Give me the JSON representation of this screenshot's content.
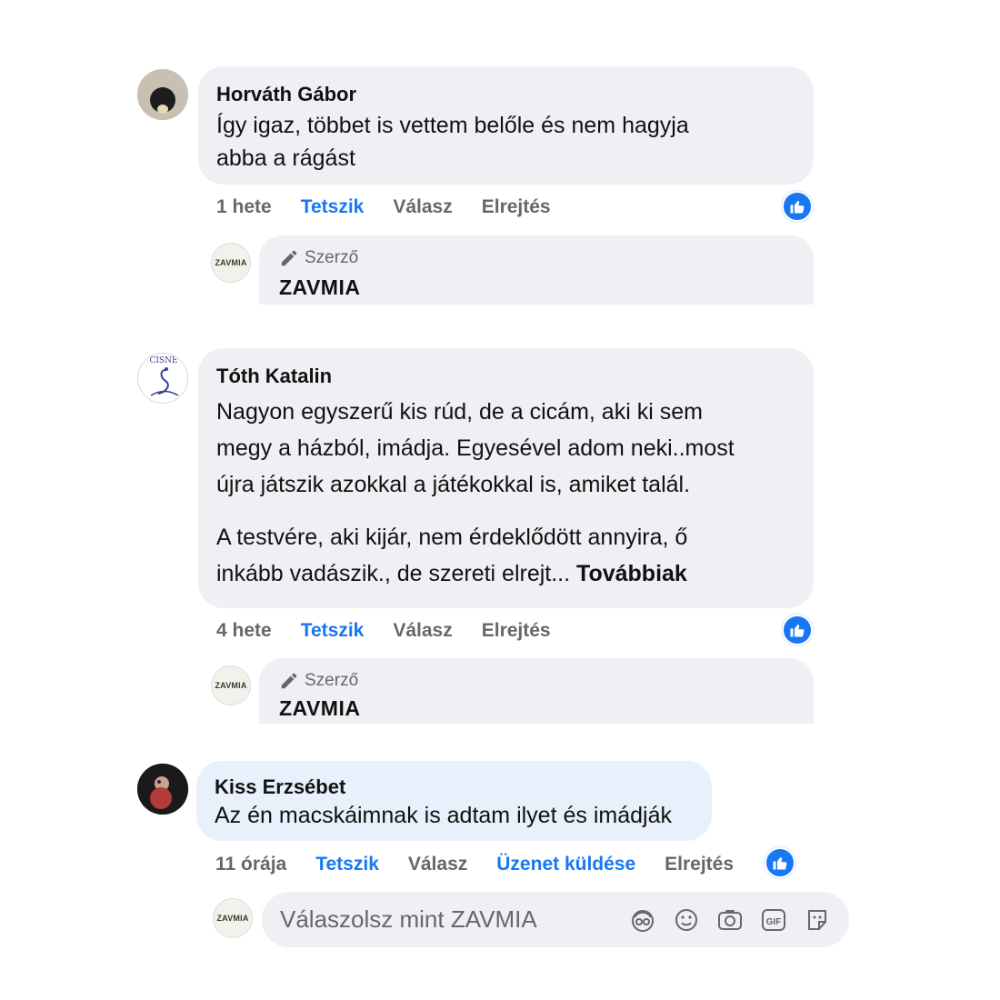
{
  "comments": [
    {
      "author": "Horváth Gábor",
      "text_lines": [
        "Így igaz, többet is vettem belőle és nem hagyja",
        "abba a rágást"
      ],
      "time": "1 hete",
      "like": "Tetszik",
      "reply": "Válasz",
      "hide": "Elrejtés",
      "reply_badge": "Szerző",
      "reply_author": "ZAVMIA"
    },
    {
      "author": "Tóth Katalin",
      "avatar_text": "CISNE",
      "paragraph1": [
        "Nagyon egyszerű kis rúd, de a cicám, aki ki sem",
        "megy a házból, imádja. Egyesével adom neki..most",
        "újra játszik azokkal a játékokkal is, amiket talál."
      ],
      "paragraph2_line1": "A testvére, aki kijár, nem érdeklődött annyira, ő",
      "paragraph2_line2": "inkább vadászik., de szereti elrejt...",
      "more": "Továbbiak",
      "time": "4 hete",
      "like": "Tetszik",
      "reply": "Válasz",
      "hide": "Elrejtés",
      "reply_badge": "Szerző",
      "reply_author": "ZAVMIA"
    },
    {
      "author": "Kiss Erzsébet",
      "text": "Az én macskáimnak is adtam ilyet és imádják",
      "time": "11 órája",
      "like": "Tetszik",
      "reply": "Válasz",
      "message": "Üzenet küldése",
      "hide": "Elrejtés"
    }
  ],
  "page_avatar_text": "ZAVMIA",
  "composer": {
    "placeholder": "Válaszolsz mint ZAVMIA",
    "icons": [
      "avatar-sticker-icon",
      "emoji-icon",
      "camera-icon",
      "gif-icon",
      "sticker-icon"
    ]
  },
  "colors": {
    "accent": "#1877f2",
    "bubble": "#eff0f4",
    "highlight": "#e7f0fb",
    "muted": "#65676b"
  }
}
